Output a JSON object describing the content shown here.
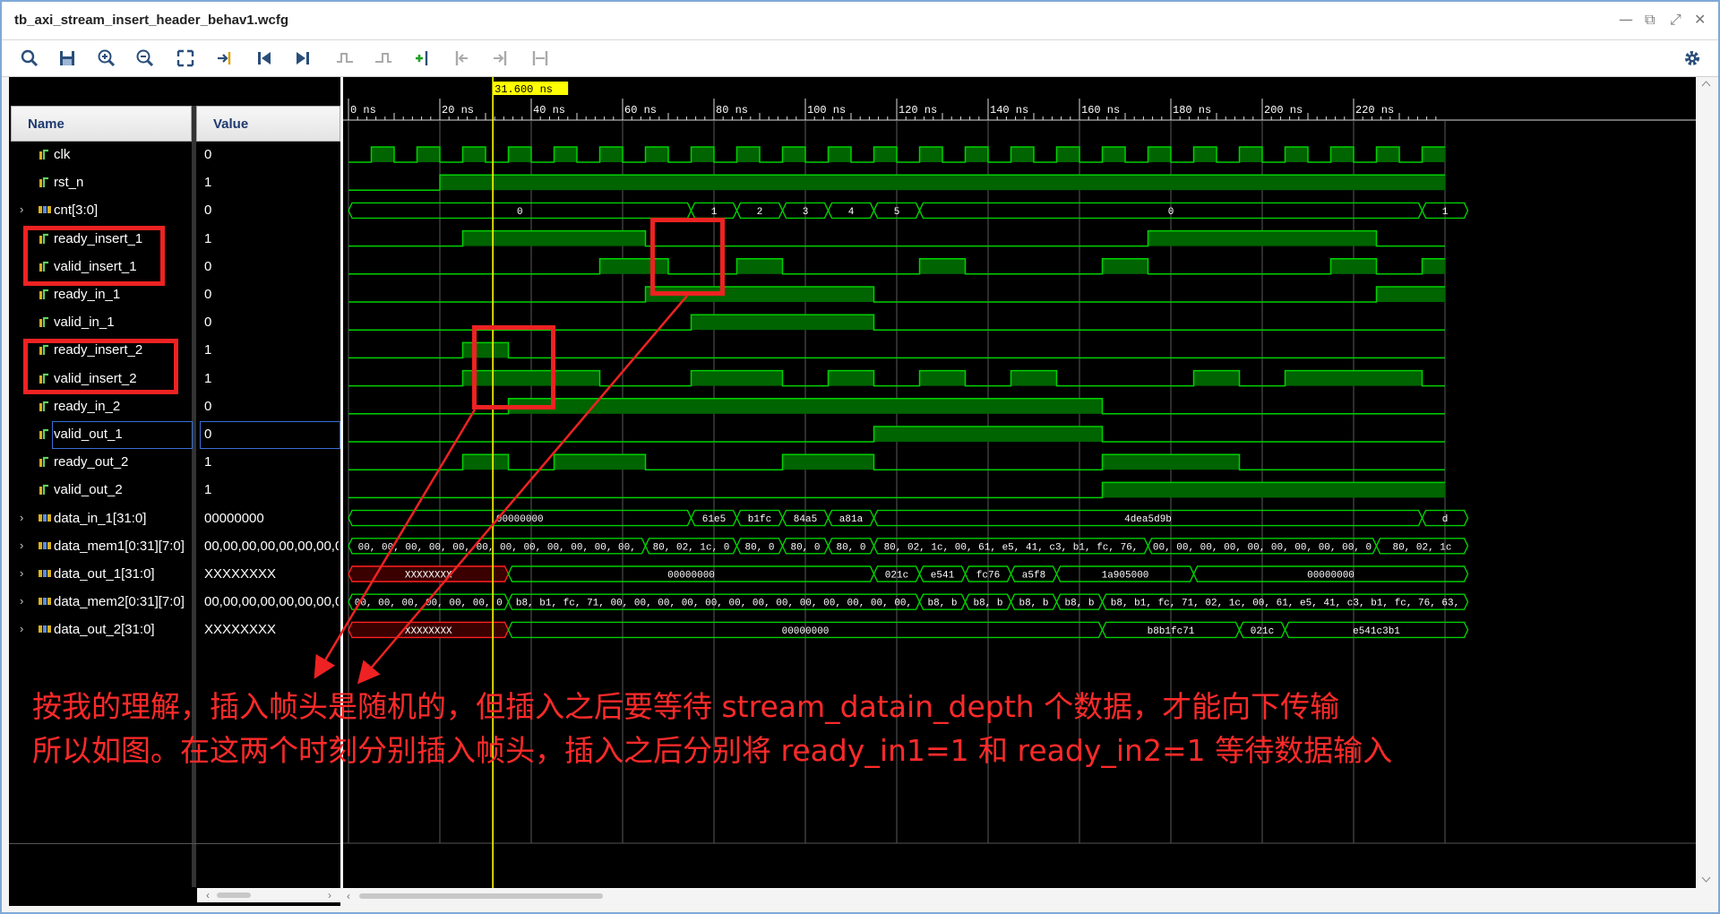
{
  "window": {
    "title": "tb_axi_stream_insert_header_behav1.wcfg",
    "controls": [
      "—",
      "⧉",
      "⤢",
      "✕"
    ]
  },
  "toolbar": {
    "buttons": [
      "search-icon",
      "save-icon",
      "zoom-in-icon",
      "zoom-out-icon",
      "zoom-fit-icon",
      "go-to-cursor-icon",
      "go-to-start-icon",
      "go-to-end-icon",
      "previous-transition-icon",
      "next-transition-icon",
      "add-marker-icon",
      "previous-marker-icon",
      "next-marker-icon",
      "swap-cursors-icon"
    ],
    "settings_icon": "gear-icon"
  },
  "columns": {
    "name": "Name",
    "value": "Value"
  },
  "signals": [
    {
      "name": "clk",
      "value": "0",
      "bus": false
    },
    {
      "name": "rst_n",
      "value": "1",
      "bus": false
    },
    {
      "name": "cnt[3:0]",
      "value": "0",
      "bus": true
    },
    {
      "name": "ready_insert_1",
      "value": "1",
      "bus": false
    },
    {
      "name": "valid_insert_1",
      "value": "0",
      "bus": false
    },
    {
      "name": "ready_in_1",
      "value": "0",
      "bus": false
    },
    {
      "name": "valid_in_1",
      "value": "0",
      "bus": false
    },
    {
      "name": "ready_insert_2",
      "value": "1",
      "bus": false
    },
    {
      "name": "valid_insert_2",
      "value": "1",
      "bus": false
    },
    {
      "name": "ready_in_2",
      "value": "0",
      "bus": false
    },
    {
      "name": "valid_out_1",
      "value": "0",
      "bus": false,
      "selected": true
    },
    {
      "name": "ready_out_2",
      "value": "1",
      "bus": false
    },
    {
      "name": "valid_out_2",
      "value": "1",
      "bus": false
    },
    {
      "name": "data_in_1[31:0]",
      "value": "00000000",
      "bus": true
    },
    {
      "name": "data_mem1[0:31][7:0]",
      "value": "00,00,00,00,00,00,00,0",
      "bus": true
    },
    {
      "name": "data_out_1[31:0]",
      "value": "XXXXXXXX",
      "bus": true
    },
    {
      "name": "data_mem2[0:31][7:0]",
      "value": "00,00,00,00,00,00,00,0",
      "bus": true
    },
    {
      "name": "data_out_2[31:0]",
      "value": "XXXXXXXX",
      "bus": true
    }
  ],
  "cursor": {
    "label": "31.600 ns",
    "time_ns": 31.6
  },
  "timeline": {
    "ticks": [
      "0 ns",
      "20 ns",
      "40 ns",
      "60 ns",
      "80 ns",
      "100 ns",
      "120 ns",
      "140 ns",
      "160 ns",
      "180 ns",
      "200 ns",
      "220 ns"
    ],
    "ns_per_major": 20,
    "visible_ns": [
      0,
      240
    ]
  },
  "waves": {
    "clk": {
      "kind": "clock",
      "period_ns": 10,
      "high_from_ns": 5
    },
    "rst_n": {
      "kind": "bit",
      "edges": [
        [
          0,
          0
        ],
        [
          20,
          1
        ]
      ]
    },
    "ready_insert_1": {
      "kind": "bit",
      "edges": [
        [
          0,
          0
        ],
        [
          25,
          1
        ],
        [
          65,
          0
        ],
        [
          175,
          1
        ],
        [
          225,
          0
        ]
      ]
    },
    "valid_insert_1": {
      "kind": "bit",
      "edges": [
        [
          0,
          0
        ],
        [
          55,
          1
        ],
        [
          70,
          0
        ],
        [
          85,
          1
        ],
        [
          95,
          0
        ],
        [
          125,
          1
        ],
        [
          135,
          0
        ],
        [
          165,
          1
        ],
        [
          175,
          0
        ],
        [
          215,
          1
        ],
        [
          225,
          0
        ],
        [
          235,
          1
        ]
      ]
    },
    "ready_in_1": {
      "kind": "bit",
      "edges": [
        [
          0,
          0
        ],
        [
          65,
          1
        ],
        [
          115,
          0
        ],
        [
          225,
          1
        ]
      ]
    },
    "valid_in_1": {
      "kind": "bit",
      "edges": [
        [
          0,
          0
        ],
        [
          75,
          1
        ],
        [
          115,
          0
        ]
      ]
    },
    "ready_insert_2": {
      "kind": "bit",
      "edges": [
        [
          0,
          0
        ],
        [
          25,
          1
        ],
        [
          35,
          0
        ]
      ]
    },
    "valid_insert_2": {
      "kind": "bit",
      "edges": [
        [
          0,
          0
        ],
        [
          25,
          1
        ],
        [
          55,
          0
        ],
        [
          75,
          1
        ],
        [
          95,
          0
        ],
        [
          105,
          1
        ],
        [
          115,
          0
        ],
        [
          125,
          1
        ],
        [
          135,
          0
        ],
        [
          145,
          1
        ],
        [
          155,
          0
        ],
        [
          185,
          1
        ],
        [
          195,
          0
        ],
        [
          205,
          1
        ],
        [
          235,
          0
        ]
      ]
    },
    "ready_in_2": {
      "kind": "bit",
      "edges": [
        [
          0,
          0
        ],
        [
          35,
          1
        ],
        [
          165,
          0
        ]
      ]
    },
    "valid_out_1": {
      "kind": "bit",
      "edges": [
        [
          0,
          0
        ],
        [
          115,
          1
        ],
        [
          165,
          0
        ]
      ]
    },
    "ready_out_2": {
      "kind": "bit",
      "edges": [
        [
          0,
          0
        ],
        [
          25,
          1
        ],
        [
          35,
          0
        ],
        [
          45,
          1
        ],
        [
          65,
          0
        ],
        [
          95,
          1
        ],
        [
          115,
          0
        ],
        [
          165,
          1
        ],
        [
          195,
          0
        ]
      ]
    },
    "valid_out_2": {
      "kind": "bit",
      "edges": [
        [
          0,
          0
        ],
        [
          165,
          1
        ]
      ]
    },
    "cnt[3:0]": {
      "kind": "bus",
      "segments": [
        [
          0,
          75,
          "0"
        ],
        [
          75,
          85,
          "1"
        ],
        [
          85,
          95,
          "2"
        ],
        [
          95,
          105,
          "3"
        ],
        [
          105,
          115,
          "4"
        ],
        [
          115,
          125,
          "5"
        ],
        [
          125,
          235,
          "0"
        ],
        [
          235,
          245,
          "1"
        ]
      ]
    },
    "data_in_1[31:0]": {
      "kind": "bus",
      "segments": [
        [
          0,
          75,
          "00000000"
        ],
        [
          75,
          85,
          "61e5"
        ],
        [
          85,
          95,
          "b1fc"
        ],
        [
          95,
          105,
          "84a5"
        ],
        [
          105,
          115,
          "a81a"
        ],
        [
          115,
          235,
          "4dea5d9b"
        ],
        [
          235,
          245,
          "d"
        ]
      ]
    },
    "data_mem1[0:31][7:0]": {
      "kind": "bus",
      "segments": [
        [
          0,
          65,
          "00, 00, 00, 00, 00, 00, 00, 00, 00, 00, 00, 00, 00, 00, 0"
        ],
        [
          65,
          85,
          "80, 02, 1c, 00"
        ],
        [
          85,
          95,
          "80, 0"
        ],
        [
          95,
          105,
          "80, 0"
        ],
        [
          105,
          115,
          "80, 0"
        ],
        [
          115,
          175,
          "80, 02, 1c, 00, 61, e5, 41, c3, b1, fc, 76, 63, 84,"
        ],
        [
          175,
          225,
          "00, 00, 00, 00, 00, 00, 00, 00, 00, 00, 00"
        ],
        [
          225,
          245,
          "80, 02, 1c"
        ]
      ]
    },
    "data_out_1[31:0]": {
      "kind": "bus",
      "segments": [
        [
          0,
          35,
          "XXXXXXXX",
          "x"
        ],
        [
          35,
          115,
          "00000000"
        ],
        [
          115,
          125,
          "021c"
        ],
        [
          125,
          135,
          "e541"
        ],
        [
          135,
          145,
          "fc76"
        ],
        [
          145,
          155,
          "a5f8"
        ],
        [
          155,
          185,
          "1a905000"
        ],
        [
          185,
          245,
          "00000000"
        ]
      ]
    },
    "data_mem2[0:31][7:0]": {
      "kind": "bus",
      "segments": [
        [
          0,
          35,
          "00, 00, 00, 00, 00, 00, 00,"
        ],
        [
          35,
          125,
          "b8, b1, fc, 71, 00, 00, 00, 00, 00, 00, 00, 00, 00, 00, 00, 00, 00, 00, 00, 00, 0"
        ],
        [
          125,
          135,
          "b8, b"
        ],
        [
          135,
          145,
          "b8, b"
        ],
        [
          145,
          155,
          "b8, b"
        ],
        [
          155,
          165,
          "b8, b"
        ],
        [
          165,
          245,
          "b8, b1, fc, 71, 02, 1c, 00, 61, e5, 41, c3, b1, fc, 76, 63, 84, a5,"
        ]
      ]
    },
    "data_out_2[31:0]": {
      "kind": "bus",
      "segments": [
        [
          0,
          35,
          "XXXXXXXX",
          "x"
        ],
        [
          35,
          165,
          "00000000"
        ],
        [
          165,
          195,
          "b8b1fc71"
        ],
        [
          195,
          205,
          "021c"
        ],
        [
          205,
          245,
          "e541c3b1"
        ]
      ]
    }
  },
  "annotation": {
    "line1": "按我的理解，插入帧头是随机的，但插入之后要等待 stream_datain_depth 个数据，才能向下传输",
    "line2": "所以如图。在这两个时刻分别插入帧头，插入之后分别将 ready_in1=1 和 ready_in2=1 等待数据输入"
  },
  "colors": {
    "wave": "#00d000",
    "wave_fill": "#006400",
    "cursor": "#ffff00",
    "x_value": "#ff2020",
    "annotation": "#ff2a2a",
    "background": "#000000"
  }
}
